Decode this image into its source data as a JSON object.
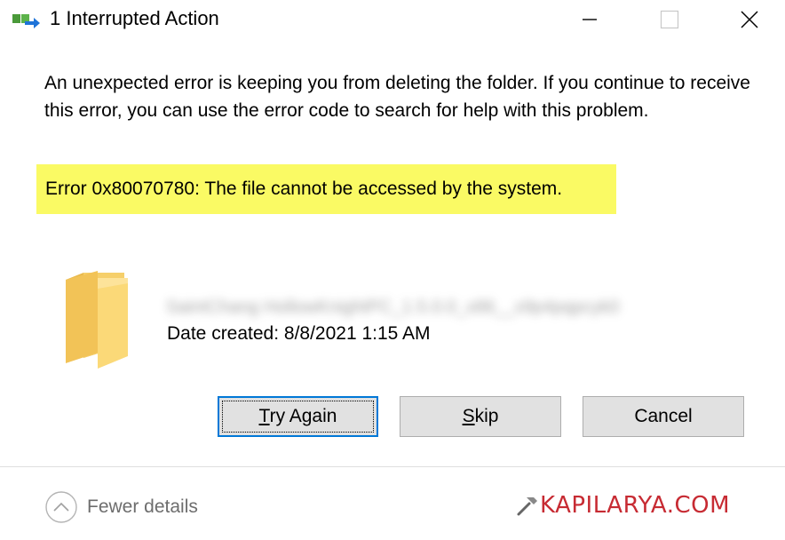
{
  "window": {
    "title": "1 Interrupted Action",
    "app_icon": "file-move-icon",
    "controls": [
      "minimize-icon",
      "maximize-icon",
      "close-icon"
    ]
  },
  "message": {
    "body": "An unexpected error is keeping you from deleting the folder. If you continue to receive this error, you can use the error code to search for help with this problem.",
    "error": "Error 0x80070780: The file cannot be accessed by the system.",
    "highlight_color": "#fafa64"
  },
  "item": {
    "icon": "folder-icon",
    "name": "SaintChang HollowKnightPC_1.5.0.0_x86__x9p4pqpcyk0",
    "date_created": "Date created: 8/8/2021 1:15 AM"
  },
  "buttons": {
    "try_again": {
      "mnemonic": "T",
      "rest": "ry Again"
    },
    "skip": {
      "mnemonic": "S",
      "rest": "kip"
    },
    "cancel": "Cancel",
    "accent": "#0078d7"
  },
  "footer": {
    "fewer_details": "Fewer details",
    "chevron_icon": "chevron-up-icon"
  },
  "watermark": {
    "text": "KAPILARYA.COM",
    "color": "#c72b33",
    "icon": "hammer-icon"
  }
}
